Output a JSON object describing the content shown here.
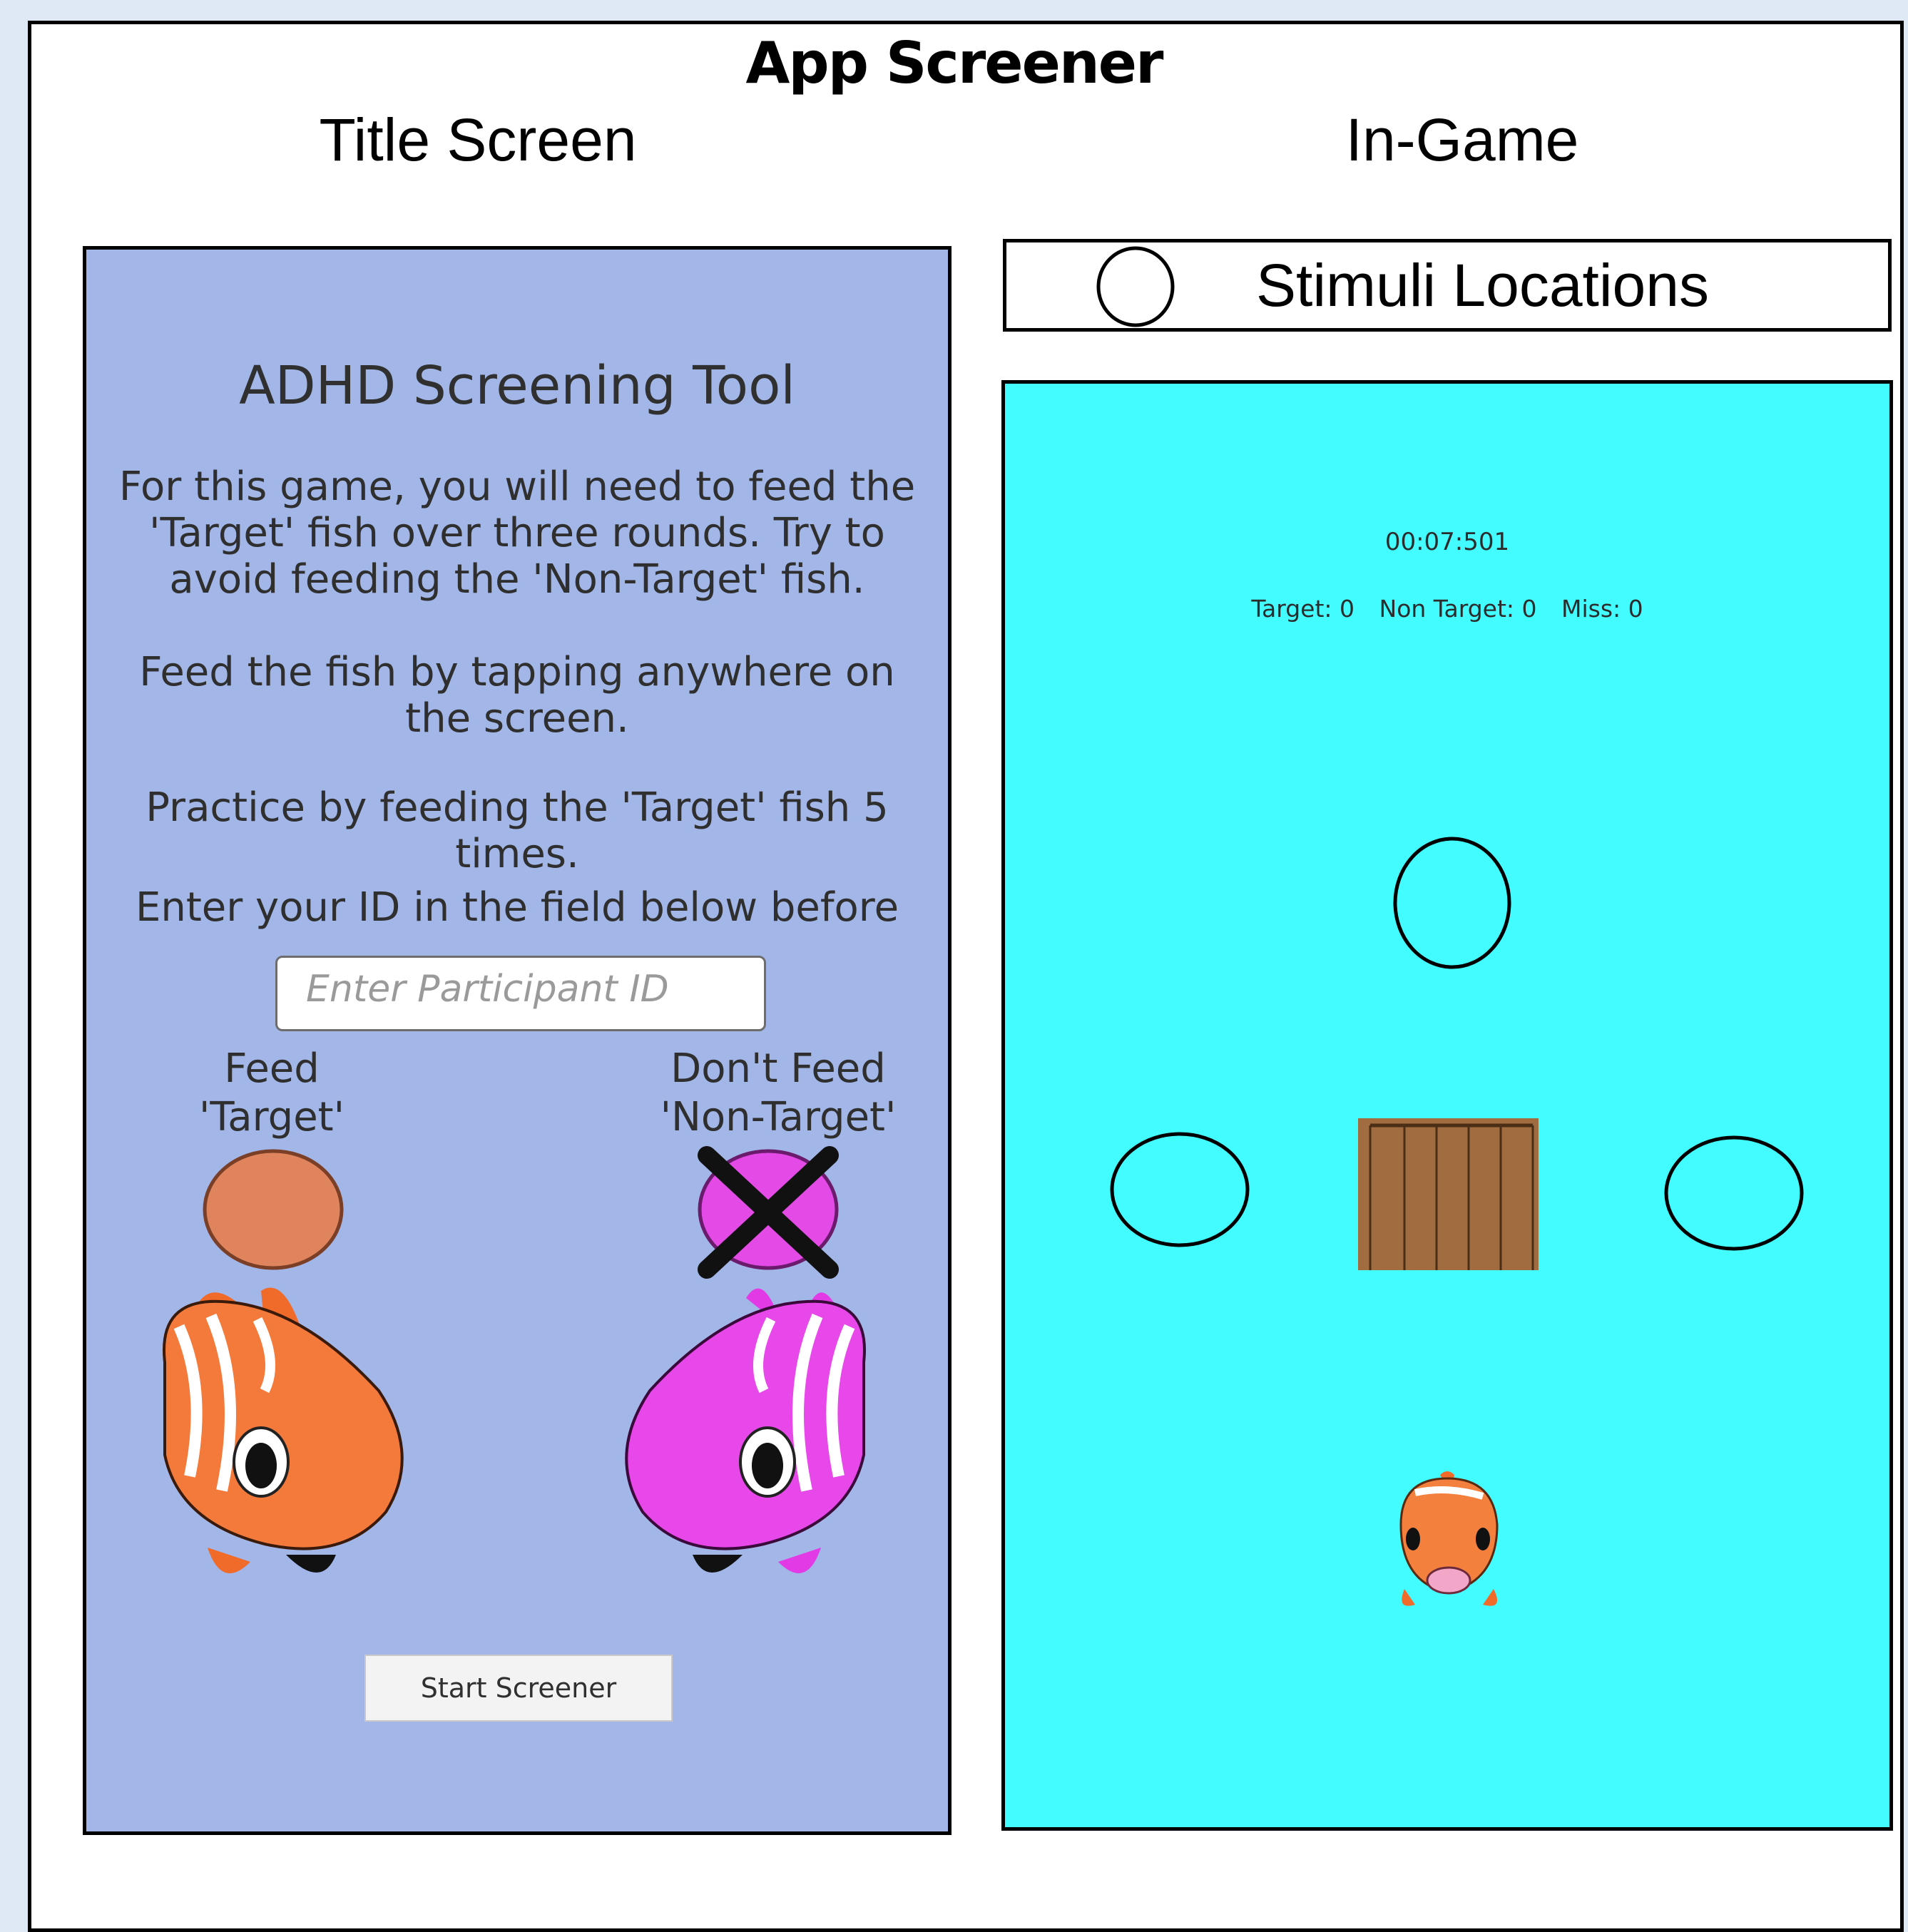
{
  "header": {
    "title": "App Screener",
    "left_label": "Title Screen",
    "right_label": "In-Game"
  },
  "title_screen": {
    "heading": "ADHD Screening Tool",
    "paragraph1": "For this game, you will need to feed the 'Target' fish over three rounds. Try to avoid feeding the 'Non-Target' fish.",
    "paragraph2": "Feed the fish by tapping anywhere on the screen.",
    "paragraph3": "Practice by feeding the 'Target' fish 5 times.",
    "paragraph4": "Enter your ID in the field below before",
    "id_placeholder": "Enter Participant ID",
    "feed_line1": "Feed",
    "feed_line2": "'Target'",
    "dontfeed_line1": "Don't Feed",
    "dontfeed_line2": "'Non-Target'",
    "start_button": "Start Screener"
  },
  "legend": {
    "label": "Stimuli Locations",
    "icon": "circle-outline-icon"
  },
  "in_game": {
    "timer": "00:07:501",
    "target": "Target: 0",
    "non_target": "Non Target: 0",
    "miss": "Miss: 0"
  },
  "colors": {
    "title_bg": "#a2b6e8",
    "game_bg": "#42fcff",
    "target_color": "#e0845e",
    "non_target_color": "#e44ae6",
    "crate": "#a06c40"
  }
}
